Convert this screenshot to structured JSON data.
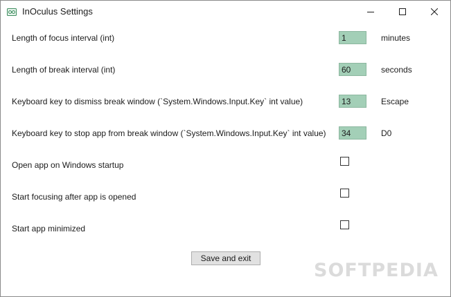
{
  "window": {
    "title": "InOculus Settings",
    "app_icon": "glasses-icon",
    "controls": [
      "minimize-icon",
      "maximize-icon",
      "close-icon"
    ]
  },
  "settings": [
    {
      "label": "Length of focus interval (int)",
      "value": "1",
      "unit": "minutes"
    },
    {
      "label": "Length of break interval (int)",
      "value": "60",
      "unit": "seconds"
    },
    {
      "label": "Keyboard key to dismiss break window (`System.Windows.Input.Key` int value)",
      "value": "13",
      "unit": "Escape"
    },
    {
      "label": "Keyboard key to stop app from break window (`System.Windows.Input.Key` int value)",
      "value": "34",
      "unit": "D0"
    }
  ],
  "toggles": [
    {
      "label": "Open app on Windows startup",
      "checked": false
    },
    {
      "label": "Start focusing after app is opened",
      "checked": false
    },
    {
      "label": "Start app minimized",
      "checked": false
    }
  ],
  "save_button": "Save and exit",
  "watermark": "SOFTPEDIA",
  "colors": {
    "field_background": "#a3cfb7",
    "button_background": "#e1e1e1"
  }
}
